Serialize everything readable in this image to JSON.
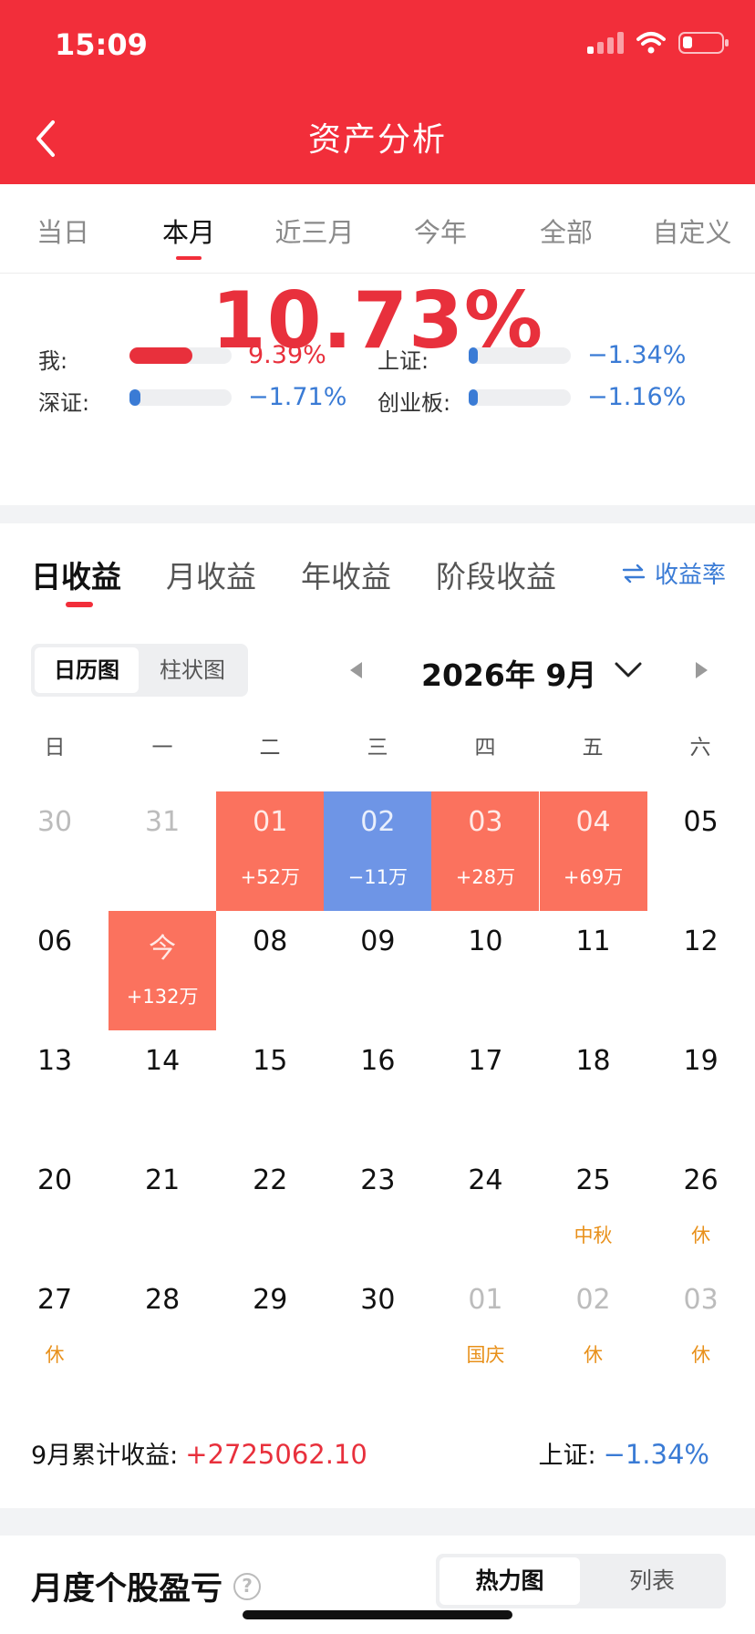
{
  "status_bar": {
    "time": "15:09"
  },
  "header": {
    "title": "资产分析"
  },
  "period_tabs": [
    {
      "label": "当日",
      "active": false
    },
    {
      "label": "本月",
      "active": true
    },
    {
      "label": "近三月",
      "active": false
    },
    {
      "label": "今年",
      "active": false
    },
    {
      "label": "全部",
      "active": false
    },
    {
      "label": "自定义",
      "active": false
    }
  ],
  "summary": {
    "return_pct": "10.73%",
    "comparisons": [
      {
        "label": "我:",
        "value": "9.39%",
        "fill_fraction": 0.62,
        "color": "#e8303c"
      },
      {
        "label": "上证:",
        "value": "−1.34%",
        "fill_fraction": 0.09,
        "color": "#3a7bd5"
      },
      {
        "label": "深证:",
        "value": "−1.71%",
        "fill_fraction": 0.11,
        "color": "#3a7bd5"
      },
      {
        "label": "创业板:",
        "value": "−1.16%",
        "fill_fraction": 0.08,
        "color": "#3a7bd5"
      }
    ]
  },
  "return_tabs": [
    {
      "label": "日收益",
      "active": true
    },
    {
      "label": "月收益",
      "active": false
    },
    {
      "label": "年收益",
      "active": false
    },
    {
      "label": "阶段收益",
      "active": false
    }
  ],
  "rate_toggle": {
    "label": "收益率",
    "icon": "swap-arrows-icon"
  },
  "view_toggle": {
    "calendar": "日历图",
    "bar": "柱状图"
  },
  "month_nav": {
    "label": "2026年 9月"
  },
  "weekdays": [
    "日",
    "一",
    "二",
    "三",
    "四",
    "五",
    "六"
  ],
  "calendar": [
    {
      "day": "30",
      "sub": "",
      "type": "muted"
    },
    {
      "day": "31",
      "sub": "",
      "type": "muted"
    },
    {
      "day": "01",
      "sub": "+52万",
      "type": "up"
    },
    {
      "day": "02",
      "sub": "−11万",
      "type": "down"
    },
    {
      "day": "03",
      "sub": "+28万",
      "type": "up"
    },
    {
      "day": "04",
      "sub": "+69万",
      "type": "up"
    },
    {
      "day": "05",
      "sub": "",
      "type": "normal"
    },
    {
      "day": "06",
      "sub": "",
      "type": "normal"
    },
    {
      "day": "今",
      "sub": "+132万",
      "type": "up"
    },
    {
      "day": "08",
      "sub": "",
      "type": "normal"
    },
    {
      "day": "09",
      "sub": "",
      "type": "normal"
    },
    {
      "day": "10",
      "sub": "",
      "type": "normal"
    },
    {
      "day": "11",
      "sub": "",
      "type": "normal"
    },
    {
      "day": "12",
      "sub": "",
      "type": "normal"
    },
    {
      "day": "13",
      "sub": "",
      "type": "normal"
    },
    {
      "day": "14",
      "sub": "",
      "type": "normal"
    },
    {
      "day": "15",
      "sub": "",
      "type": "normal"
    },
    {
      "day": "16",
      "sub": "",
      "type": "normal"
    },
    {
      "day": "17",
      "sub": "",
      "type": "normal"
    },
    {
      "day": "18",
      "sub": "",
      "type": "normal"
    },
    {
      "day": "19",
      "sub": "",
      "type": "normal"
    },
    {
      "day": "20",
      "sub": "",
      "type": "normal"
    },
    {
      "day": "21",
      "sub": "",
      "type": "normal"
    },
    {
      "day": "22",
      "sub": "",
      "type": "normal"
    },
    {
      "day": "23",
      "sub": "",
      "type": "normal"
    },
    {
      "day": "24",
      "sub": "",
      "type": "normal"
    },
    {
      "day": "25",
      "sub": "中秋",
      "type": "holiday"
    },
    {
      "day": "26",
      "sub": "休",
      "type": "holiday"
    },
    {
      "day": "27",
      "sub": "休",
      "type": "holiday"
    },
    {
      "day": "28",
      "sub": "",
      "type": "normal"
    },
    {
      "day": "29",
      "sub": "",
      "type": "normal"
    },
    {
      "day": "30",
      "sub": "",
      "type": "normal"
    },
    {
      "day": "01",
      "sub": "国庆",
      "type": "muted-holiday"
    },
    {
      "day": "02",
      "sub": "休",
      "type": "muted-holiday"
    },
    {
      "day": "03",
      "sub": "休",
      "type": "muted-holiday"
    }
  ],
  "totals": {
    "month_label": "9月累计收益:",
    "month_value": "+2725062.10",
    "index_label": "上证:",
    "index_value": "−1.34%"
  },
  "bottom": {
    "title": "月度个股盈亏",
    "toggle": {
      "heatmap": "热力图",
      "list": "列表"
    }
  },
  "colors": {
    "brand_red": "#f22e3a",
    "gain": "#fb725e",
    "loss": "#6e95e6",
    "holiday": "#e8901a",
    "accent_blue": "#3a7bd5"
  }
}
